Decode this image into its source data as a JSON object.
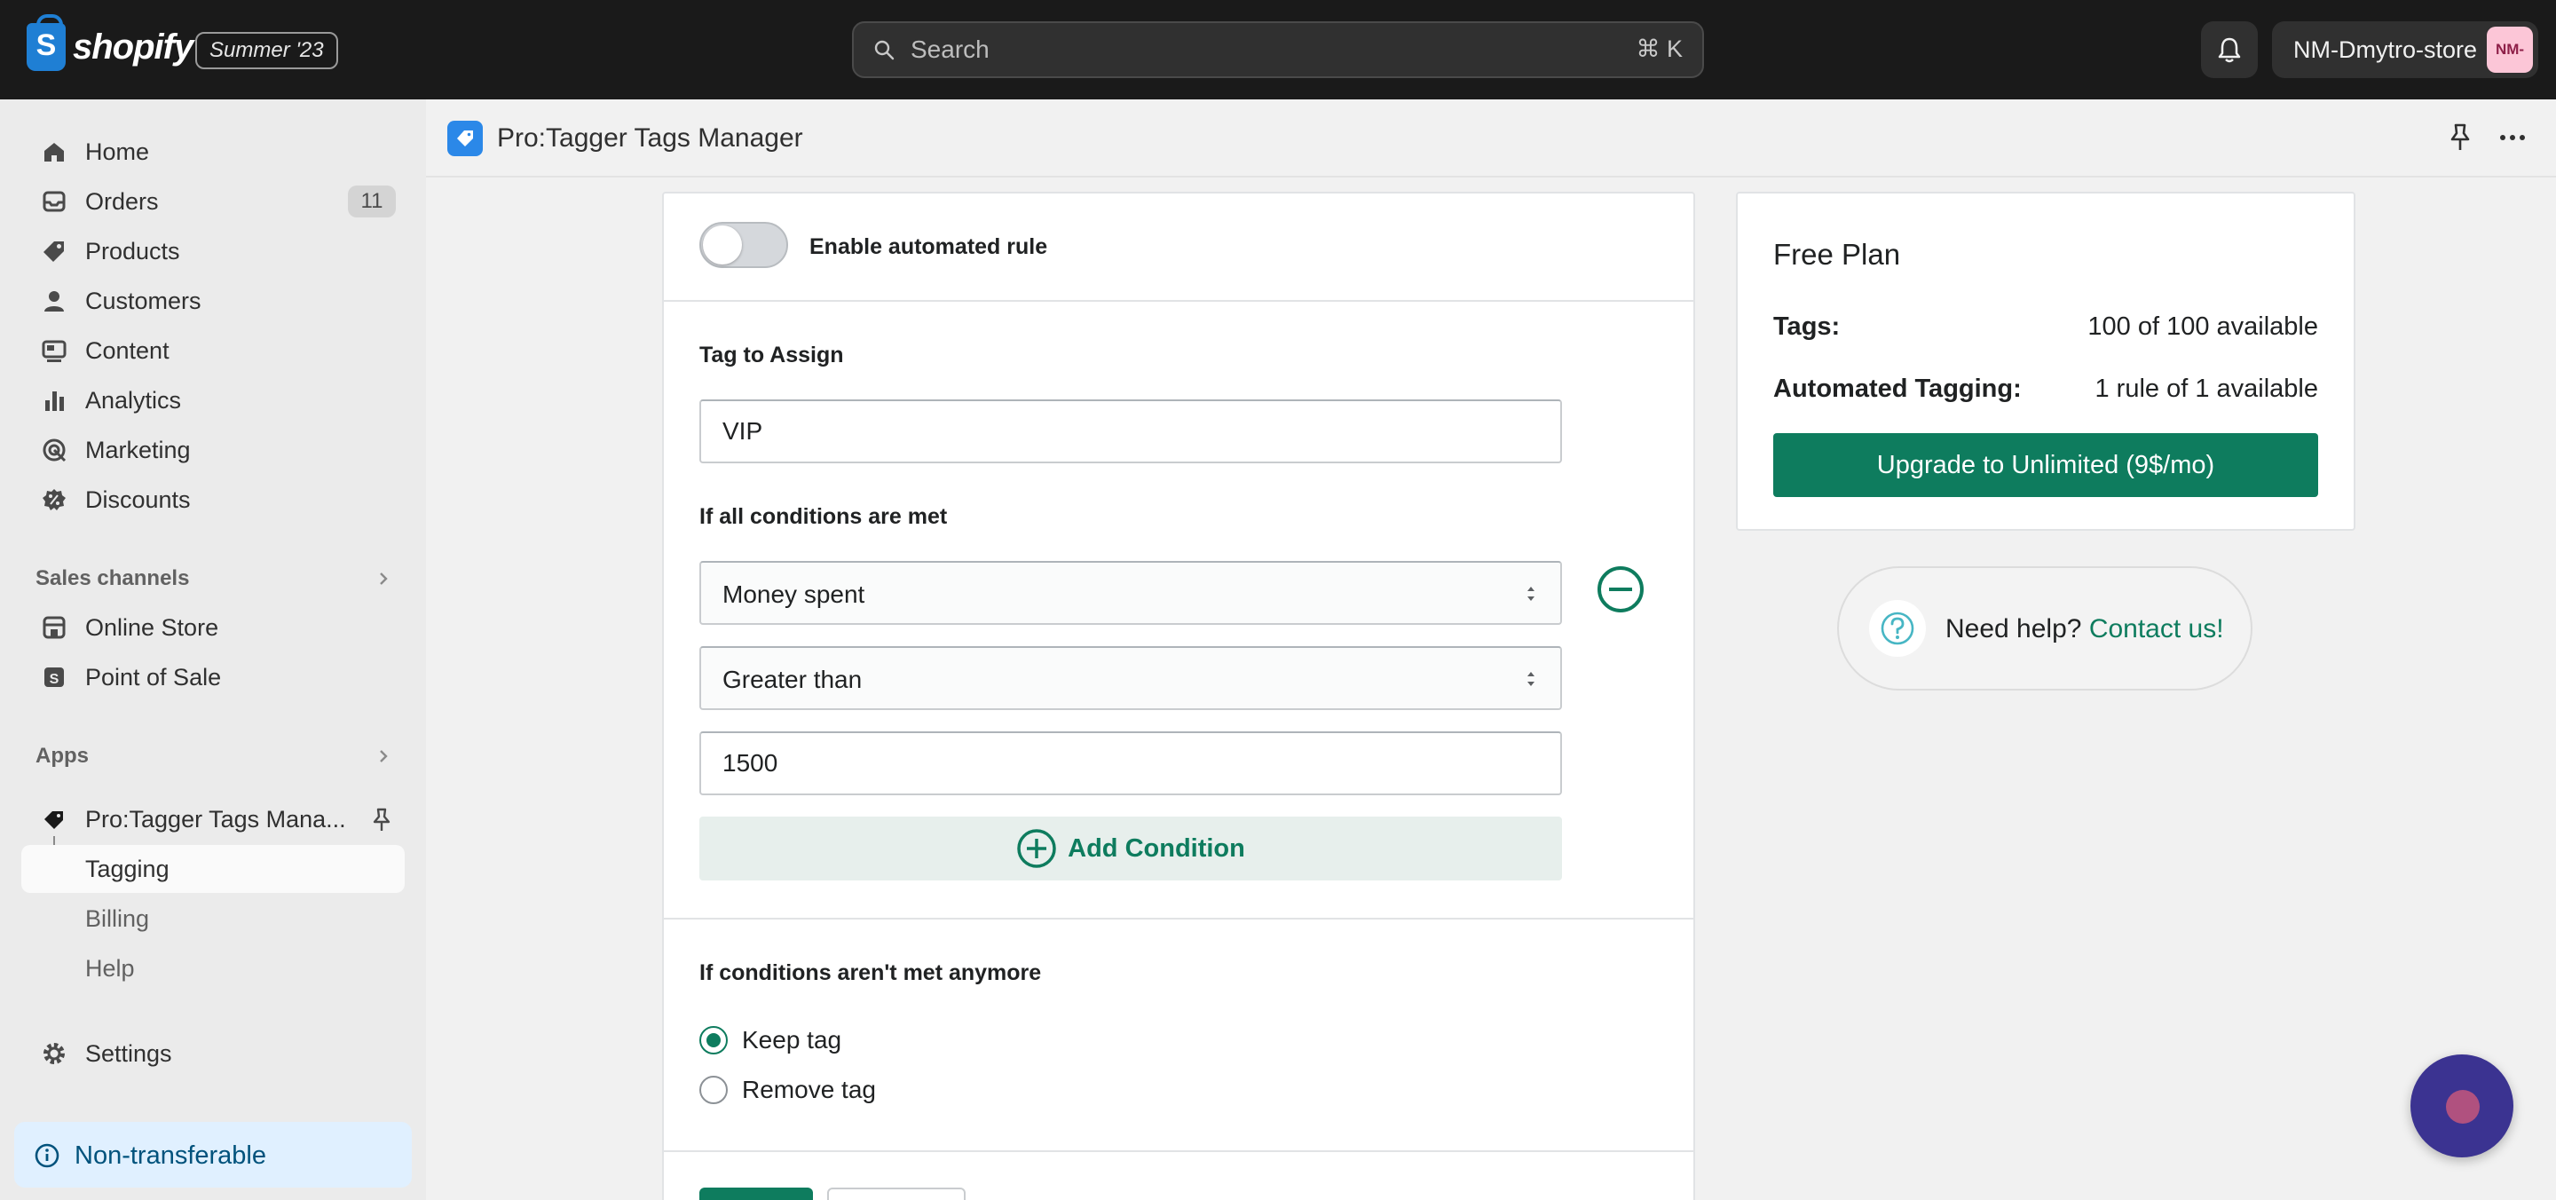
{
  "topbar": {
    "logo_mark": "S",
    "logo_word": "shopify",
    "edition_badge": "Summer '23",
    "search_placeholder": "Search",
    "search_shortcut": "⌘ K",
    "store_name": "NM-Dmytro-store",
    "avatar_initials": "NM-"
  },
  "sidebar": {
    "items": [
      {
        "label": "Home",
        "icon": "home-icon"
      },
      {
        "label": "Orders",
        "icon": "orders-icon",
        "count": "11"
      },
      {
        "label": "Products",
        "icon": "tag-icon"
      },
      {
        "label": "Customers",
        "icon": "person-icon"
      },
      {
        "label": "Content",
        "icon": "content-icon"
      },
      {
        "label": "Analytics",
        "icon": "bar-chart-icon"
      },
      {
        "label": "Marketing",
        "icon": "target-icon"
      },
      {
        "label": "Discounts",
        "icon": "discount-icon"
      }
    ],
    "sales_channels_label": "Sales channels",
    "sales_channels": [
      {
        "label": "Online Store",
        "icon": "store-icon"
      },
      {
        "label": "Point of Sale",
        "icon": "pos-icon"
      }
    ],
    "apps_label": "Apps",
    "app_name": "Pro:Tagger Tags Mana...",
    "app_subitems": [
      "Tagging",
      "Billing",
      "Help"
    ],
    "settings_label": "Settings",
    "non_transferable": "Non-transferable"
  },
  "app_header": {
    "title": "Pro:Tagger Tags Manager"
  },
  "rule_form": {
    "toggle_label": "Enable automated rule",
    "toggle_on": false,
    "tag_label": "Tag to Assign",
    "tag_value": "VIP",
    "conditions_label": "If all conditions are met",
    "condition_field": "Money spent",
    "condition_operator": "Greater than",
    "condition_value": "1500",
    "add_condition_label": "Add Condition",
    "unmet_label": "If conditions aren't met anymore",
    "unmet_options": [
      {
        "label": "Keep tag",
        "checked": true
      },
      {
        "label": "Remove tag",
        "checked": false
      }
    ]
  },
  "plan": {
    "title": "Free Plan",
    "tags_label": "Tags:",
    "tags_value": "100 of 100 available",
    "automated_label": "Automated Tagging:",
    "automated_value": "1 rule of 1 available",
    "upgrade_label": "Upgrade to Unlimited (9$/mo)"
  },
  "help": {
    "text": "Need help?",
    "link": "Contact us!"
  },
  "colors": {
    "accent": "#0e7c5e",
    "topbar": "#1a1a1a",
    "info_bg": "#e0f0ff"
  }
}
